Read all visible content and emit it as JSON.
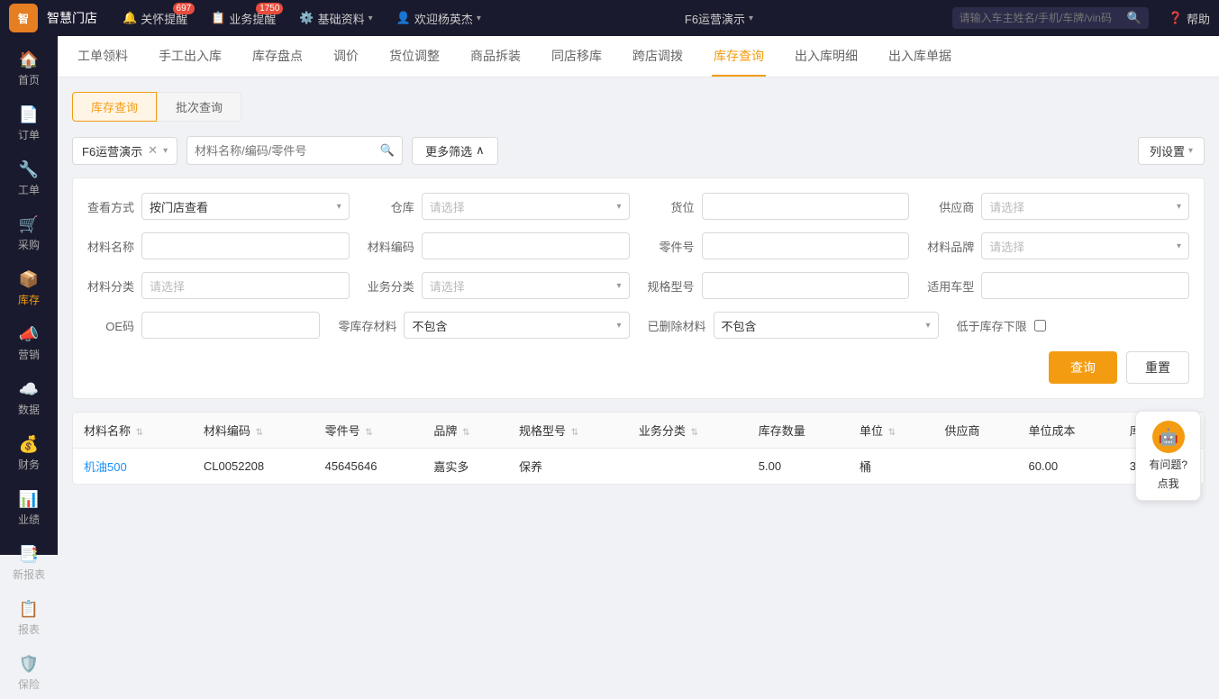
{
  "app": {
    "logo": "智",
    "name": "智慧门店"
  },
  "topnav": {
    "items": [
      {
        "id": "bell",
        "label": "关怀提醒",
        "badge": "697",
        "icon": "🔔"
      },
      {
        "id": "task",
        "label": "业务提醒",
        "badge": "1750",
        "icon": "📋"
      },
      {
        "id": "settings",
        "label": "基础资料",
        "icon": "⚙️"
      },
      {
        "id": "user",
        "label": "欢迎杨英杰",
        "icon": "👤"
      }
    ],
    "f6": "F6运营演示",
    "search_placeholder": "请输入车主姓名/手机/车牌/vin码",
    "help": "帮助"
  },
  "sidebar": {
    "items": [
      {
        "id": "home",
        "label": "首页",
        "icon": "🏠",
        "active": false
      },
      {
        "id": "order",
        "label": "订单",
        "icon": "📄",
        "active": false
      },
      {
        "id": "work",
        "label": "工单",
        "icon": "🔧",
        "active": false
      },
      {
        "id": "purchase",
        "label": "采购",
        "icon": "🛒",
        "active": false
      },
      {
        "id": "inventory",
        "label": "库存",
        "icon": "📦",
        "active": true
      },
      {
        "id": "marketing",
        "label": "营销",
        "icon": "📣",
        "active": false
      },
      {
        "id": "data",
        "label": "数据",
        "icon": "☁️",
        "active": false
      },
      {
        "id": "finance",
        "label": "财务",
        "icon": "💰",
        "active": false
      },
      {
        "id": "performance",
        "label": "业绩",
        "icon": "📊",
        "active": false
      },
      {
        "id": "report-new",
        "label": "新报表",
        "icon": "📑",
        "active": false
      },
      {
        "id": "report",
        "label": "报表",
        "icon": "📋",
        "active": false
      },
      {
        "id": "insurance",
        "label": "保险",
        "icon": "🛡️",
        "active": false
      }
    ]
  },
  "tabs": {
    "items": [
      {
        "id": "work-order",
        "label": "工单领料",
        "active": false
      },
      {
        "id": "manual",
        "label": "手工出入库",
        "active": false
      },
      {
        "id": "stocktake",
        "label": "库存盘点",
        "active": false
      },
      {
        "id": "price",
        "label": "调价",
        "active": false
      },
      {
        "id": "location",
        "label": "货位调整",
        "active": false
      },
      {
        "id": "unpack",
        "label": "商品拆装",
        "active": false
      },
      {
        "id": "transfer",
        "label": "同店移库",
        "active": false
      },
      {
        "id": "cross-transfer",
        "label": "跨店调拨",
        "active": false
      },
      {
        "id": "inventory-query",
        "label": "库存查询",
        "active": true
      },
      {
        "id": "in-out-detail",
        "label": "出入库明细",
        "active": false
      },
      {
        "id": "in-out-doc",
        "label": "出入库单据",
        "active": false
      }
    ]
  },
  "subtabs": {
    "items": [
      {
        "id": "inventory-query",
        "label": "库存查询",
        "active": true
      },
      {
        "id": "batch-query",
        "label": "批次查询",
        "active": false
      }
    ]
  },
  "filter": {
    "tag_label": "F6运营演示",
    "search_placeholder": "材料名称/编码/零件号",
    "more_filter": "更多筛选",
    "col_setting": "列设置"
  },
  "adv_filter": {
    "view_mode_label": "查看方式",
    "view_mode_value": "按门店查看",
    "warehouse_label": "仓库",
    "warehouse_placeholder": "请选择",
    "location_label": "货位",
    "supplier_label": "供应商",
    "supplier_placeholder": "请选择",
    "material_name_label": "材料名称",
    "material_code_label": "材料编码",
    "part_no_label": "零件号",
    "brand_label": "材料品牌",
    "brand_placeholder": "请选择",
    "material_category_label": "材料分类",
    "material_category_placeholder": "请选择",
    "biz_category_label": "业务分类",
    "biz_category_placeholder": "请选择",
    "spec_label": "规格型号",
    "vehicle_label": "适用车型",
    "oe_label": "OE码",
    "zero_stock_label": "零库存材料",
    "zero_stock_value": "不包含",
    "deleted_label": "已删除材料",
    "deleted_value": "不包含",
    "below_min_label": "低于库存下限",
    "query_btn": "查询",
    "reset_btn": "重置"
  },
  "table": {
    "columns": [
      {
        "id": "name",
        "label": "材料名称",
        "sortable": true
      },
      {
        "id": "code",
        "label": "材料编码",
        "sortable": true
      },
      {
        "id": "part_no",
        "label": "零件号",
        "sortable": true
      },
      {
        "id": "brand",
        "label": "品牌",
        "sortable": true
      },
      {
        "id": "spec",
        "label": "规格型号",
        "sortable": true
      },
      {
        "id": "biz_cat",
        "label": "业务分类",
        "sortable": true
      },
      {
        "id": "qty",
        "label": "库存数量",
        "sortable": false
      },
      {
        "id": "unit",
        "label": "单位",
        "sortable": true
      },
      {
        "id": "supplier",
        "label": "供应商",
        "sortable": false
      },
      {
        "id": "unit_cost",
        "label": "单位成本",
        "sortable": false
      },
      {
        "id": "inventory",
        "label": "库存",
        "sortable": false
      }
    ],
    "rows": [
      {
        "name": "机油500",
        "code": "CL0052208",
        "part_no": "45645646",
        "brand": "嘉实多",
        "spec": "保养",
        "biz_cat": "",
        "qty": "5.00",
        "unit": "桶",
        "supplier": "",
        "unit_cost": "60.00",
        "inventory": "300.00"
      }
    ]
  },
  "chat": {
    "label": "有问题?",
    "action": "点我"
  }
}
